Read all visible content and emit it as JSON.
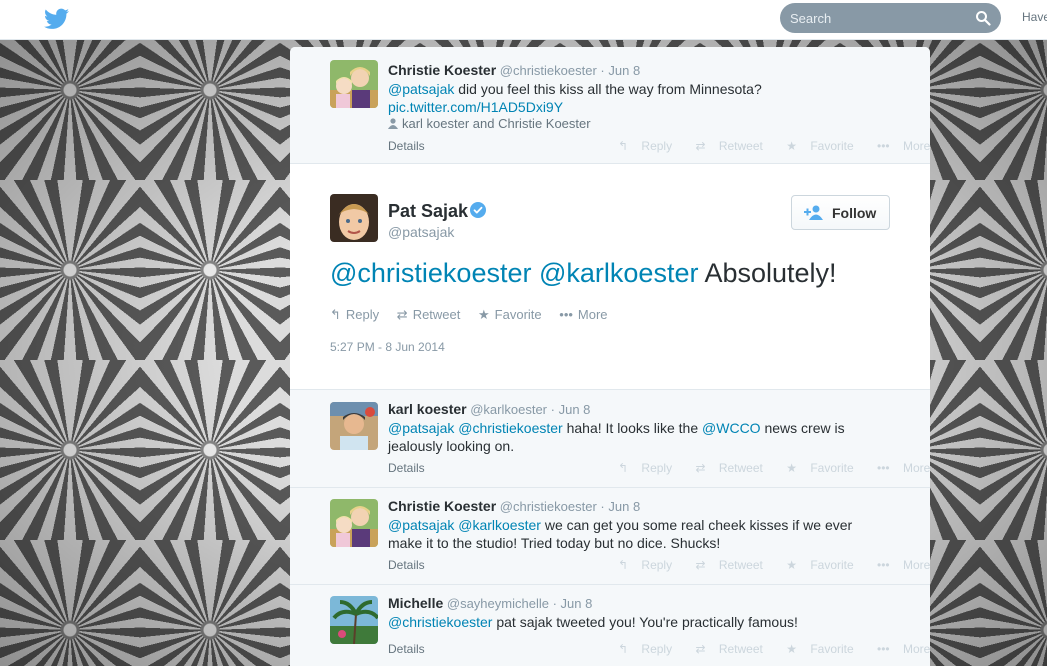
{
  "topbar": {
    "search_placeholder": "Search",
    "have_link": "Have"
  },
  "top_reply": {
    "name": "Christie Koester",
    "handle": "@christiekoester",
    "date": "Jun 8",
    "text_mention": "@patsajak",
    "text_body": " did you feel this kiss all the way from Minnesota?",
    "link": "pic.twitter.com/H1AD5Dxi9Y",
    "tagged": "karl koester and Christie Koester",
    "details": "Details"
  },
  "permalink": {
    "name": "Pat Sajak",
    "handle": "@patsajak",
    "follow_label": "Follow",
    "text_mention_1": "@christiekoester",
    "text_mention_2": "@karlkoester",
    "text_body": " Absolutely!",
    "actions": {
      "reply": "Reply",
      "retweet": "Retweet",
      "favorite": "Favorite",
      "more": "More"
    },
    "timestamp": "5:27 PM - 8 Jun 2014"
  },
  "faint_actions": {
    "reply": "Reply",
    "retweet": "Retweet",
    "favorite": "Favorite",
    "more": "More"
  },
  "replies": [
    {
      "name": "karl koester",
      "handle": "@karlkoester",
      "date": "Jun 8",
      "mention_1": "@patsajak",
      "mention_2": "@christiekoester",
      "body_1": " haha! It looks like the ",
      "mention_3": "@WCCO",
      "body_2": " news crew is",
      "line_2": "jealously looking on.",
      "details": "Details"
    },
    {
      "name": "Christie Koester",
      "handle": "@christiekoester",
      "date": "Jun 8",
      "mention_1": "@patsajak",
      "mention_2": "@karlkoester",
      "body_1": " we can get you some real cheek kisses if we ever",
      "line_2": "make it to the studio! Tried today but no dice. Shucks!",
      "details": "Details"
    },
    {
      "name": "Michelle",
      "handle": "@sayheymichelle",
      "date": "Jun 8",
      "mention_1": "@christiekoester",
      "body_1": " pat sajak tweeted you! You're practically famous!",
      "details": "Details"
    }
  ],
  "separator_dot": "·",
  "colors": {
    "link": "#0084b4",
    "muted": "#8899a6",
    "verified": "#55acee",
    "twitter_blue": "#55acee"
  },
  "icons": [
    "twitter-bird-icon",
    "search-icon",
    "verified-badge-icon",
    "follow-user-icon",
    "reply-icon",
    "retweet-icon",
    "favorite-icon",
    "more-icon",
    "person-tag-icon"
  ]
}
